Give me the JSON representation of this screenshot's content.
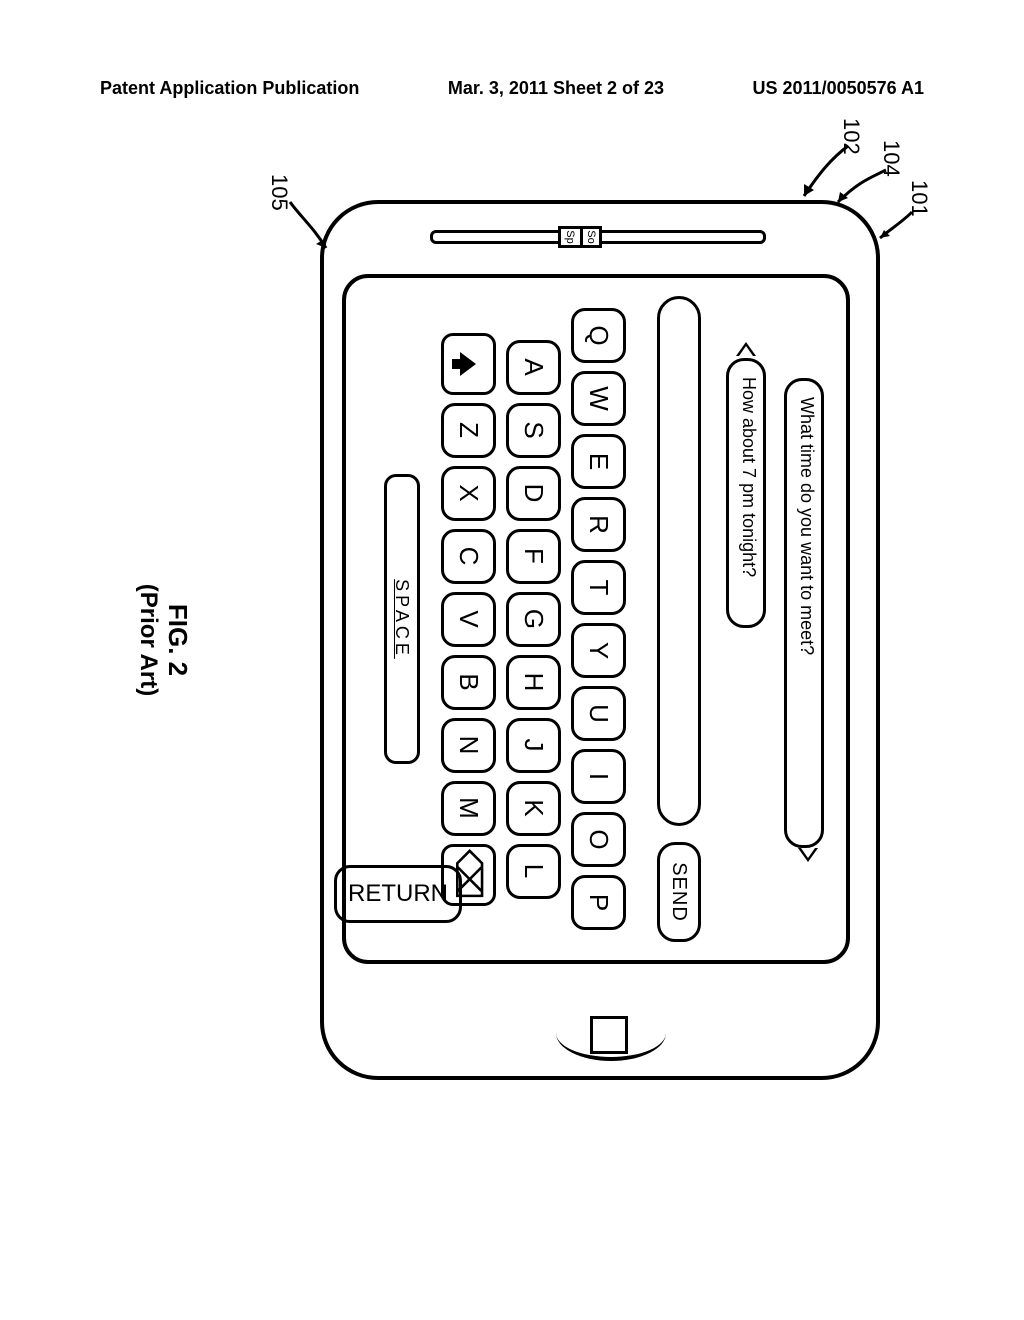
{
  "header": {
    "left": "Patent Application Publication",
    "middle": "Mar. 3, 2011  Sheet 2 of 23",
    "right": "US 2011/0050576 A1"
  },
  "figure": {
    "caption_line1": "FIG. 2",
    "caption_line2": "(Prior Art)"
  },
  "refs": {
    "r101": "101",
    "r102": "102",
    "r104": "104",
    "r105": "105"
  },
  "slider": {
    "top": "So",
    "bot": "Sp"
  },
  "messages": {
    "received": "What time do you want to meet?",
    "sent": "How about 7 pm tonight?"
  },
  "compose": {
    "send": "SEND"
  },
  "keyboard": {
    "row1": [
      "Q",
      "W",
      "E",
      "R",
      "T",
      "Y",
      "U",
      "I",
      "O",
      "P"
    ],
    "row2": [
      "A",
      "S",
      "D",
      "F",
      "G",
      "H",
      "J",
      "K",
      "L"
    ],
    "row3": [
      "Z",
      "X",
      "C",
      "V",
      "B",
      "N",
      "M"
    ],
    "space": "SPACE",
    "return": "RETURN",
    "backspace_glyph": "⌫"
  }
}
